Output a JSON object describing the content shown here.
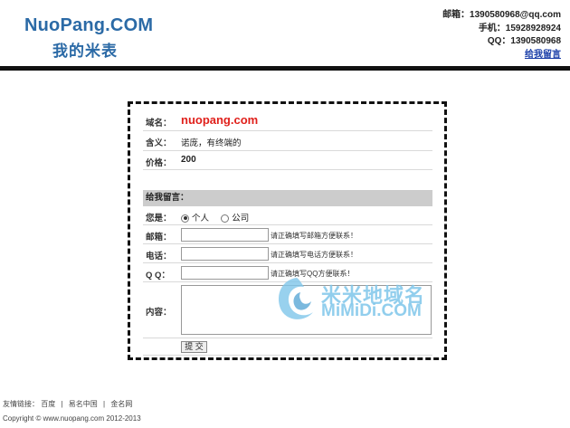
{
  "header": {
    "logo_main": "NuoPang.COM",
    "logo_sub": "我的米表",
    "email_line": "邮箱：1390580968@qq.com",
    "phone_line": "手机：15928928924",
    "qq_line": "QQ：1390580968",
    "message_link": "给我留言"
  },
  "domain_info": {
    "domain_label": "域名：",
    "domain_value": "nuopang.com",
    "meaning_label": "含义：",
    "meaning_value": "诺庞，有终端的",
    "price_label": "价格：",
    "price_value": "200"
  },
  "form": {
    "section_title": "给我留言：",
    "identity_label": "您是：",
    "option_personal": "个人",
    "option_company": "公司",
    "selected": "个人",
    "email_label": "邮箱：",
    "email_hint": "请正确填写邮箱方便联系！",
    "phone_label": "电话：",
    "phone_hint": "请正确填写电话方便联系！",
    "qq_label": "Q Q：",
    "qq_hint": "请正确填写QQ方便联系！",
    "content_label": "内容：",
    "submit_label": "提 交"
  },
  "watermark": {
    "cn": "米米地域名",
    "en": "MiMiDi.COM"
  },
  "footer": {
    "links_label": "友情链接：",
    "link1": "百度",
    "sep": "|",
    "link2": "易名中国",
    "link3": "金名网",
    "copyright": "Copyright © www.nuopang.com 2012-2013"
  },
  "colors": {
    "brand": "#2b6aa6",
    "domain": "#e0201b",
    "bar": "#111111"
  }
}
